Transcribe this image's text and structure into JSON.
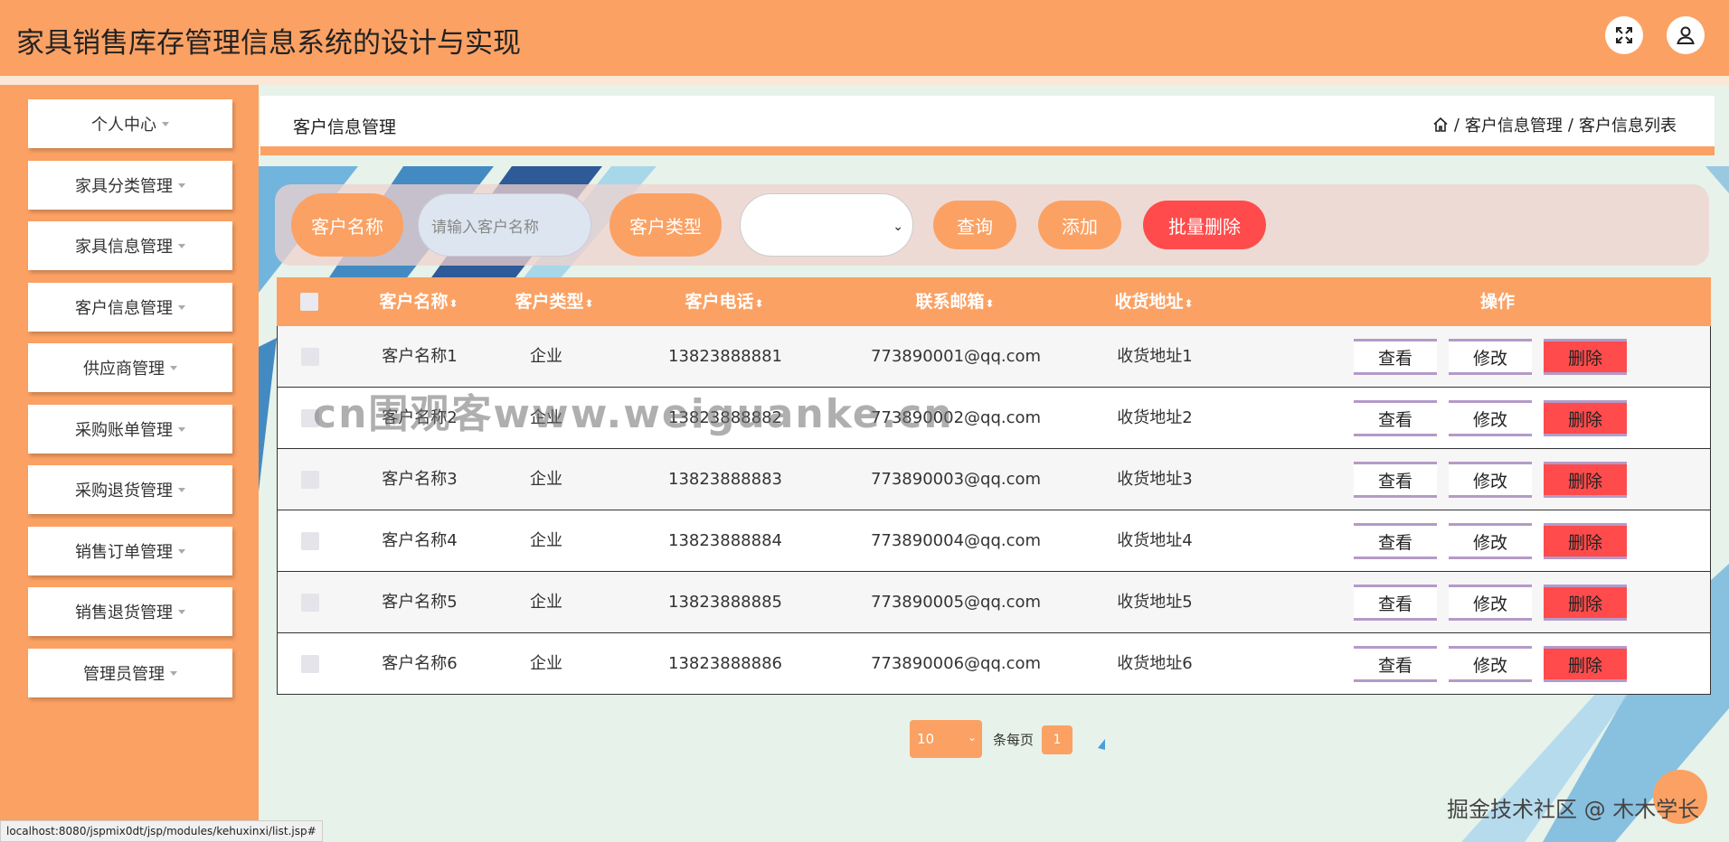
{
  "app": {
    "title": "家具销售库存管理信息系统的设计与实现"
  },
  "header_icons": {
    "expand": "expand-icon",
    "user": "user-icon"
  },
  "sidebar": {
    "items": [
      {
        "label": "个人中心"
      },
      {
        "label": "家具分类管理"
      },
      {
        "label": "家具信息管理"
      },
      {
        "label": "客户信息管理"
      },
      {
        "label": "供应商管理"
      },
      {
        "label": "采购账单管理"
      },
      {
        "label": "采购退货管理"
      },
      {
        "label": "销售订单管理"
      },
      {
        "label": "销售退货管理"
      },
      {
        "label": "管理员管理"
      }
    ]
  },
  "page": {
    "title": "客户信息管理",
    "breadcrumb": [
      "客户信息管理",
      "客户信息列表"
    ],
    "breadcrumb_sep": "/"
  },
  "search": {
    "name_label": "客户名称",
    "name_placeholder": "请输入客户名称",
    "type_label": "客户类型",
    "type_value": "",
    "query_label": "查询",
    "add_label": "添加",
    "batch_delete_label": "批量删除"
  },
  "table": {
    "headers": [
      "客户名称",
      "客户类型",
      "客户电话",
      "联系邮箱",
      "收货地址",
      "操作"
    ],
    "rows": [
      {
        "name": "客户名称1",
        "type": "企业",
        "phone": "13823888881",
        "email": "773890001@qq.com",
        "address": "收货地址1"
      },
      {
        "name": "客户名称2",
        "type": "企业",
        "phone": "13823888882",
        "email": "773890002@qq.com",
        "address": "收货地址2"
      },
      {
        "name": "客户名称3",
        "type": "企业",
        "phone": "13823888883",
        "email": "773890003@qq.com",
        "address": "收货地址3"
      },
      {
        "name": "客户名称4",
        "type": "企业",
        "phone": "13823888884",
        "email": "773890004@qq.com",
        "address": "收货地址4"
      },
      {
        "name": "客户名称5",
        "type": "企业",
        "phone": "13823888885",
        "email": "773890005@qq.com",
        "address": "收货地址5"
      },
      {
        "name": "客户名称6",
        "type": "企业",
        "phone": "13823888886",
        "email": "773890006@qq.com",
        "address": "收货地址6"
      }
    ],
    "actions": {
      "view": "查看",
      "edit": "修改",
      "delete": "删除"
    }
  },
  "pagination": {
    "page_size": "10",
    "per_page_label": "条每页",
    "current_page": "1"
  },
  "overlay": {
    "watermark": "cn围观客www.weiguanke.cn",
    "credit": "掘金技术社区 @ 木木学长",
    "status_url": "localhost:8080/jspmix0dt/jsp/modules/kehuxinxi/list.jsp#"
  },
  "colors": {
    "primary": "#fba163",
    "danger": "#ff4b4b",
    "content_bg": "#e6f2ea"
  }
}
